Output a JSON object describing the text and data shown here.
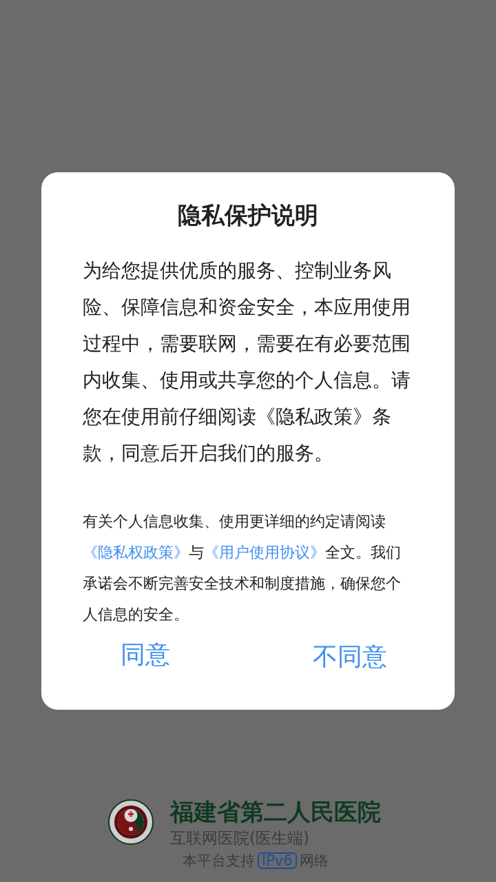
{
  "dialog": {
    "title": "隐私保护说明",
    "body": "为给您提供优质的服务、控制业务风险、保障信息和资金安全，本应用使用过程中，需要联网，需要在有必要范围内收集、使用或共享您的个人信息。请您在使用前仔细阅读《隐私政策》条款，同意后开启我们的服务。",
    "note": [
      {
        "kind": "text",
        "text": "有关个人信息收集、使用更详细的约定请阅读"
      },
      {
        "kind": "link",
        "text": "《隐私权政策》"
      },
      {
        "kind": "text",
        "text": "与"
      },
      {
        "kind": "link",
        "text": "《用户使用协议》"
      },
      {
        "kind": "text",
        "text": "全文。我们承诺会不断完善安全技术和制度措施，确保您个人信息的安全。"
      }
    ],
    "buttons": [
      "同意",
      "不同意"
    ]
  },
  "footer": {
    "hospital_name": "福建省第二人民医院",
    "subtitle": "互联网医院(医生端)",
    "support_prefix": "本平台支持",
    "support_badge": "IPv6",
    "support_suffix": "网络"
  }
}
